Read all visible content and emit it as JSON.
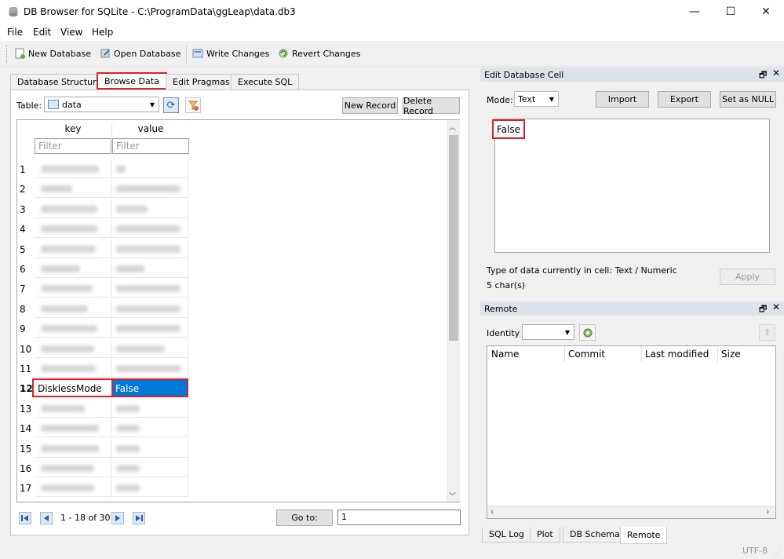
{
  "window": {
    "title": "DB Browser for SQLite - C:\\ProgramData\\ggLeap\\data.db3",
    "minimize": "—",
    "maximize": "☐",
    "close": "✕"
  },
  "menu": [
    "File",
    "Edit",
    "View",
    "Help"
  ],
  "toolbar": {
    "new_db": "New Database",
    "open_db": "Open Database",
    "write": "Write Changes",
    "revert": "Revert Changes"
  },
  "tabs": [
    "Database Structure",
    "Browse Data",
    "Edit Pragmas",
    "Execute SQL"
  ],
  "browse": {
    "table_label": "Table:",
    "table_value": "data",
    "new_record": "New Record",
    "delete_record": "Delete Record",
    "columns": [
      "key",
      "value"
    ],
    "filter_placeholder": "Filter",
    "rows": [
      {
        "num": "1",
        "key": "",
        "value": ""
      },
      {
        "num": "2",
        "key": "",
        "value": ""
      },
      {
        "num": "3",
        "key": "",
        "value": ""
      },
      {
        "num": "4",
        "key": "",
        "value": ""
      },
      {
        "num": "5",
        "key": "",
        "value": ""
      },
      {
        "num": "6",
        "key": "",
        "value": ""
      },
      {
        "num": "7",
        "key": "",
        "value": ""
      },
      {
        "num": "8",
        "key": "",
        "value": ""
      },
      {
        "num": "9",
        "key": "",
        "value": ""
      },
      {
        "num": "10",
        "key": "",
        "value": ""
      },
      {
        "num": "11",
        "key": "",
        "value": ""
      },
      {
        "num": "12",
        "key": "DisklessMode",
        "value": "False"
      },
      {
        "num": "13",
        "key": "",
        "value": ""
      },
      {
        "num": "14",
        "key": "",
        "value": ""
      },
      {
        "num": "15",
        "key": "",
        "value": ""
      },
      {
        "num": "16",
        "key": "",
        "value": ""
      },
      {
        "num": "17",
        "key": "",
        "value": ""
      }
    ],
    "range_text": "1 - 18 of 30",
    "goto_label": "Go to:",
    "goto_value": "1"
  },
  "edit_cell": {
    "title": "Edit Database Cell",
    "mode_label": "Mode:",
    "mode_value": "Text",
    "import": "Import",
    "export": "Export",
    "set_null": "Set as NULL",
    "content": "False",
    "type_info": "Type of data currently in cell: Text / Numeric",
    "chars": "5 char(s)",
    "apply": "Apply"
  },
  "remote": {
    "title": "Remote",
    "identity_label": "Identity",
    "columns": [
      "Name",
      "Commit",
      "Last modified",
      "Size"
    ]
  },
  "bottom_tabs": [
    "SQL Log",
    "Plot",
    "DB Schema",
    "Remote"
  ],
  "status": {
    "encoding": "UTF-8"
  },
  "colors": {
    "highlight_red": "#e02020",
    "selection_blue": "#0078d7"
  }
}
